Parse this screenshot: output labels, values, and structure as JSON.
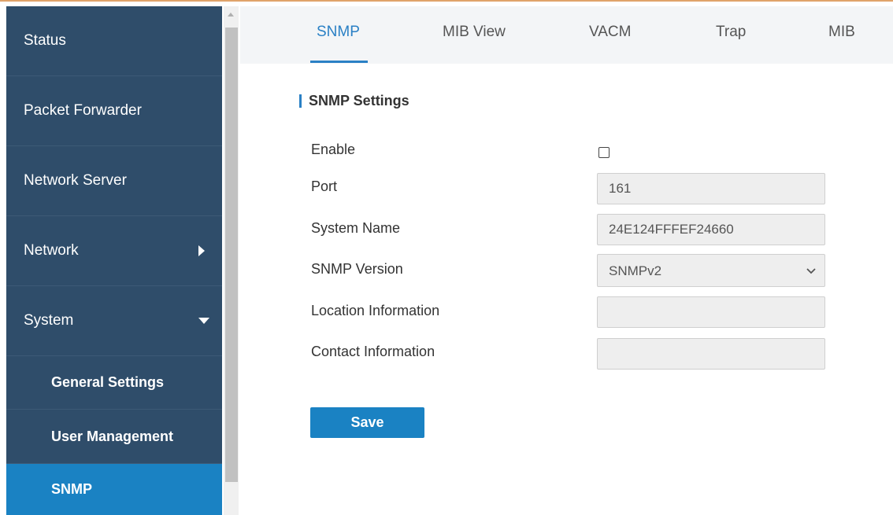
{
  "sidebar": {
    "items": [
      {
        "label": "Status"
      },
      {
        "label": "Packet Forwarder"
      },
      {
        "label": "Network Server"
      },
      {
        "label": "Network"
      },
      {
        "label": "System"
      },
      {
        "label": "General Settings"
      },
      {
        "label": "User Management"
      },
      {
        "label": "SNMP"
      }
    ]
  },
  "tabs": [
    {
      "label": "SNMP"
    },
    {
      "label": "MIB View"
    },
    {
      "label": "VACM"
    },
    {
      "label": "Trap"
    },
    {
      "label": "MIB"
    }
  ],
  "section": {
    "title": "SNMP Settings"
  },
  "form": {
    "enable_label": "Enable",
    "enable_checked": false,
    "port_label": "Port",
    "port_value": "161",
    "system_name_label": "System Name",
    "system_name_value": "24E124FFFEF24660",
    "snmp_version_label": "SNMP Version",
    "snmp_version_value": "SNMPv2",
    "location_label": "Location Information",
    "location_value": "",
    "contact_label": "Contact Information",
    "contact_value": ""
  },
  "actions": {
    "save_label": "Save"
  },
  "colors": {
    "sidebar_bg": "#2f4d6a",
    "accent": "#1a82c3",
    "tab_active": "#2a80c5"
  }
}
